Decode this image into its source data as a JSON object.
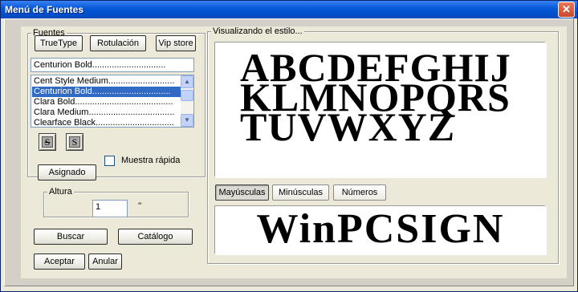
{
  "window": {
    "title": "Menú de Fuentes",
    "close_glyph": "✕"
  },
  "fonts_group": {
    "legend": "Fuentes",
    "buttons": {
      "truetype": "TrueType",
      "rotulacion": "Rotulación",
      "vip_store": "Vip store"
    },
    "combo_value": "Centurion  Bold..............................",
    "list_items": [
      {
        "label": "Cent Style Medium...........................",
        "selected": false
      },
      {
        "label": "Centurion  Bold................................",
        "selected": true
      },
      {
        "label": "Clara Bold........................................",
        "selected": false
      },
      {
        "label": "Clara Medium...................................",
        "selected": false
      },
      {
        "label": "Clearface Black................................",
        "selected": false
      }
    ],
    "scroll_up_glyph": "▲",
    "scroll_down_glyph": "▼",
    "icon_buttons": {
      "strike_glyph": "S",
      "style_glyph": "S"
    },
    "quick_sample_label": "Muestra rápida",
    "quick_sample_checked": false,
    "assigned_button": "Asignado"
  },
  "height_group": {
    "legend": "Altura",
    "value": "1",
    "unit": "''"
  },
  "actions": {
    "search": "Buscar",
    "catalog": "Catálogo",
    "accept": "Aceptar",
    "cancel": "Anular"
  },
  "preview_group": {
    "legend": "Visualizando el estilo...",
    "alphabet_lines": [
      "ABCDEFGHIJ",
      "KLMNOPQRS",
      "TUVWXYZ"
    ],
    "case_buttons": {
      "uppercase": "Mayúsculas",
      "lowercase": "Minúsculas",
      "numbers": "Números"
    },
    "active_case": "uppercase",
    "sample_text": "WinPCSIGN"
  }
}
